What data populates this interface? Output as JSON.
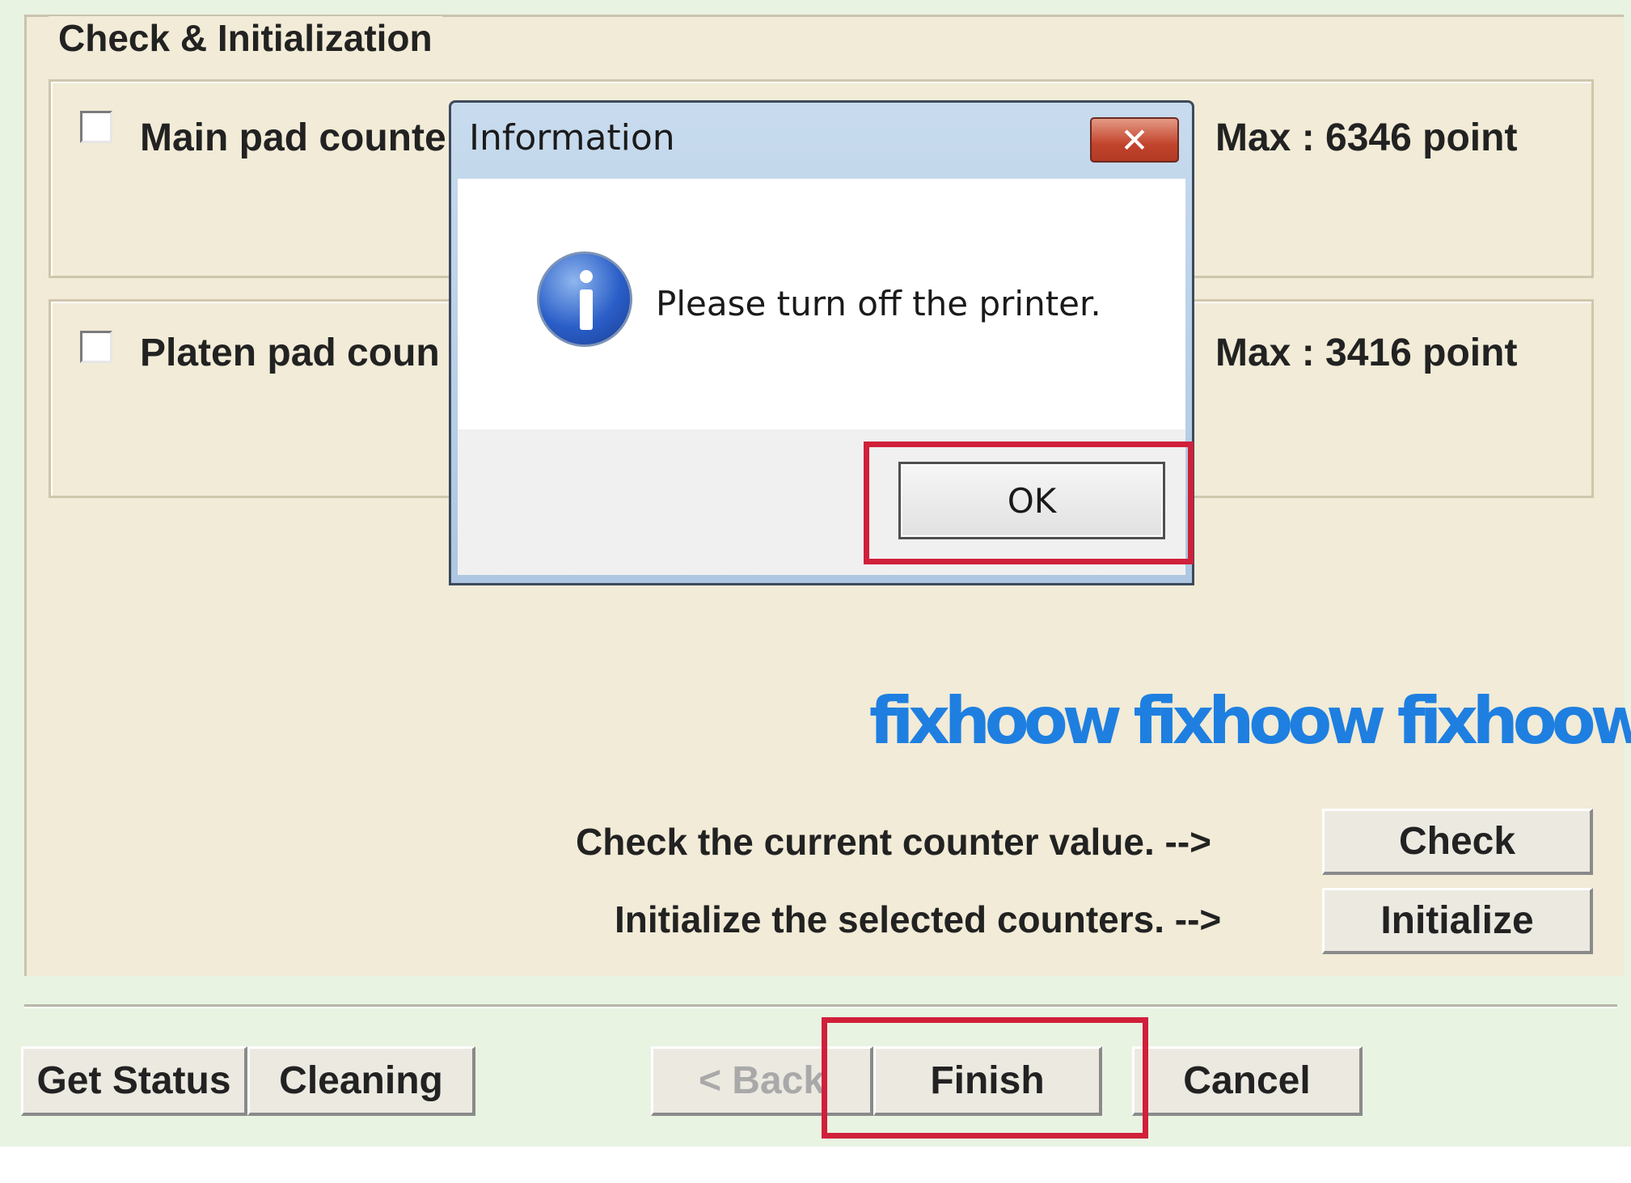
{
  "group": {
    "title": "Check & Initialization"
  },
  "panels": [
    {
      "label": "Main pad counte",
      "max": "Max : 6346 point"
    },
    {
      "label": "Platen pad coun",
      "max": "Max : 3416 point"
    }
  ],
  "watermark": "fixhoow fixhoow fixhoow",
  "actions": {
    "check_hint": "Check the current counter value. -->",
    "check_button": "Check",
    "init_hint": "Initialize the selected counters. -->",
    "init_button": "Initialize"
  },
  "footer": {
    "get_status": "Get Status",
    "cleaning": "Cleaning",
    "back": "< Back",
    "finish": "Finish",
    "cancel": "Cancel"
  },
  "dialog": {
    "title": "Information",
    "close_glyph": "✕",
    "message": "Please turn off the printer.",
    "ok": "OK",
    "icon": "info-icon"
  },
  "colors": {
    "highlight": "#d0203a",
    "watermark": "#1e7fe0",
    "group_bg": "#f1ebd7",
    "app_bg": "#e9f3e2"
  }
}
